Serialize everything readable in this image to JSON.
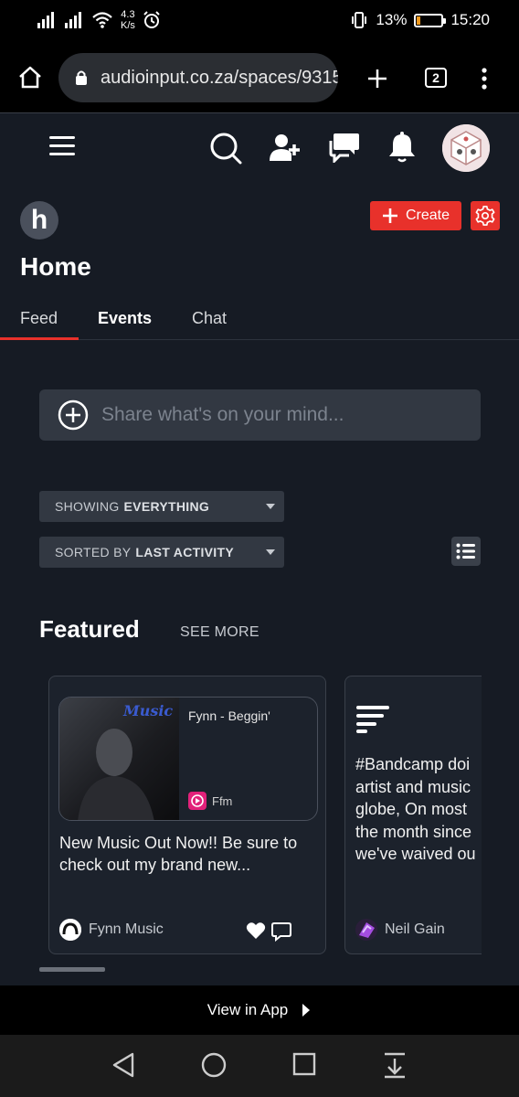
{
  "status_bar": {
    "net_speed_value": "4.3",
    "net_speed_unit": "K/s",
    "battery_percent": "13%",
    "battery_level": 0.13,
    "time": "15:20"
  },
  "browser": {
    "url": "audioinput.co.za/spaces/9315",
    "tab_count": "2"
  },
  "header": {
    "space_logo_letter": "h",
    "create_label": "Create",
    "page_title": "Home",
    "tabs": [
      {
        "label": "Feed"
      },
      {
        "label": "Events"
      },
      {
        "label": "Chat"
      }
    ]
  },
  "feed": {
    "share_placeholder": "Share what's on your mind...",
    "filter_showing_prefix": "SHOWING",
    "filter_showing_value": "EVERYTHING",
    "filter_sorted_prefix": "SORTED BY",
    "filter_sorted_value": "LAST ACTIVITY"
  },
  "featured": {
    "title": "Featured",
    "see_more": "SEE MORE",
    "cards": [
      {
        "media_title": "Fynn - Beggin'",
        "media_source": "Ffm",
        "text_line1": "New Music Out Now!! Be sure to",
        "text_line2": "check out my brand new...",
        "author": "Fynn Music"
      },
      {
        "lines": [
          "#Bandcamp doi",
          "artist and music",
          "globe, On most",
          "the month since",
          "we've waived ou"
        ],
        "author": "Neil Gain"
      }
    ]
  },
  "bottom": {
    "view_in_app": "View in App"
  },
  "colors": {
    "background": "#161b24",
    "accent_red": "#e8312b",
    "input_bg": "#323842",
    "battery_orange": "#f29a1e"
  }
}
